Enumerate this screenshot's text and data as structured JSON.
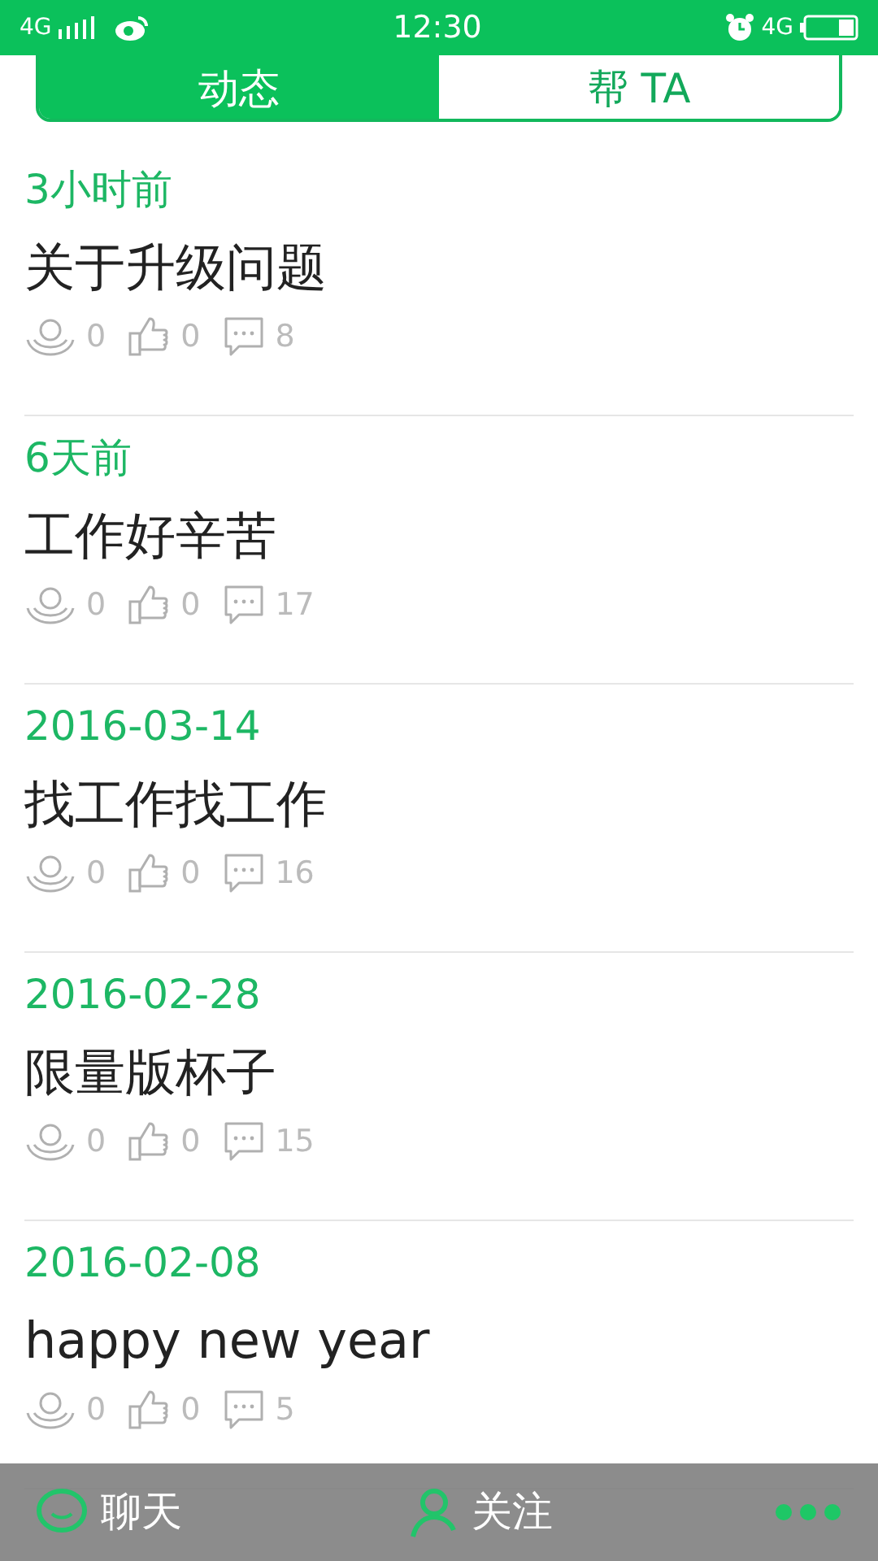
{
  "status_bar": {
    "network": "4G",
    "time": "12:30",
    "data": "4G"
  },
  "tabs": [
    {
      "label": "动态",
      "selected": true
    },
    {
      "label": "帮 TA",
      "selected": false
    }
  ],
  "posts": [
    {
      "time": "3小时前",
      "title": "关于升级问题",
      "helps": "0",
      "likes": "0",
      "comments": "8"
    },
    {
      "time": "6天前",
      "title": "工作好辛苦",
      "helps": "0",
      "likes": "0",
      "comments": "17"
    },
    {
      "time": "2016-03-14",
      "title": "找工作找工作",
      "helps": "0",
      "likes": "0",
      "comments": "16"
    },
    {
      "time": "2016-02-28",
      "title": "限量版杯子",
      "helps": "0",
      "likes": "0",
      "comments": "15"
    },
    {
      "time": "2016-02-08",
      "title": "happy new year",
      "helps": "0",
      "likes": "0",
      "comments": "5"
    }
  ],
  "bottom_bar": {
    "chat": "聊天",
    "follow": "关注"
  }
}
